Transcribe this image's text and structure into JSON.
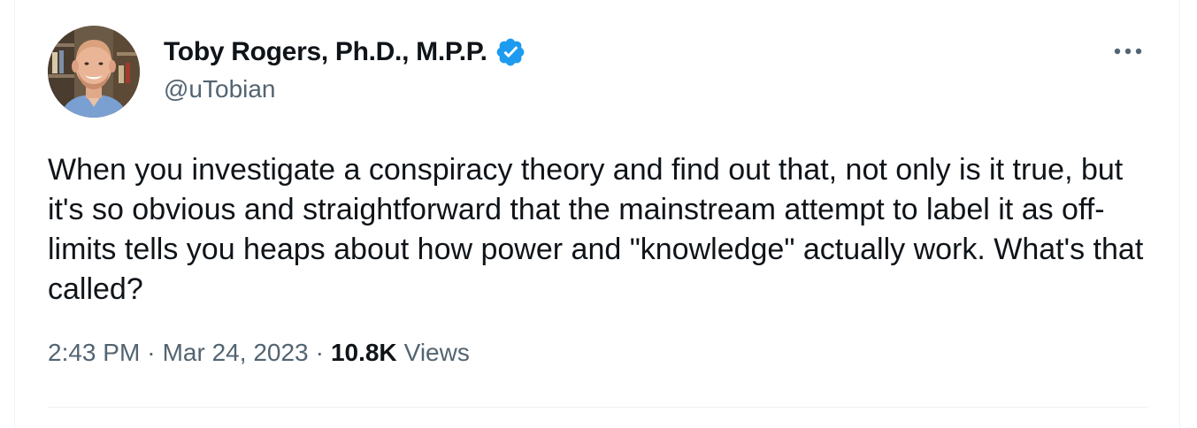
{
  "author": {
    "display_name": "Toby Rogers, Ph.D., M.P.P.",
    "handle": "@uTobian",
    "verified": true,
    "verified_color": "#1d9bf0",
    "avatar_icon": "profile-photo"
  },
  "tweet": {
    "text": "When you investigate a conspiracy theory and find out that, not only is it true, but it's so obvious and straightforward that the mainstream attempt to label it as off-limits tells you heaps about how power and \"knowledge\" actually work. What's that called?",
    "time": "2:43 PM",
    "date": "Mar 24, 2023",
    "views_count": "10.8K",
    "views_label": "Views",
    "separator": "·"
  },
  "menu": {
    "icon": "more-horizontal-icon"
  },
  "colors": {
    "text_primary": "#0f1419",
    "text_secondary": "#536471",
    "border": "#eff3f4"
  }
}
